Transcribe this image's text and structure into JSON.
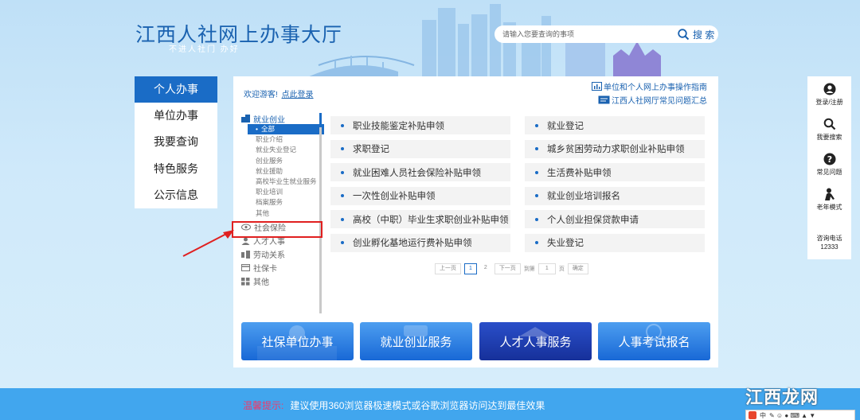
{
  "header": {
    "title": "江西人社网上办事大厅",
    "slogan": "不进人社门 办好",
    "search_placeholder": "请输入您要查询的事项",
    "search_label": "搜 索"
  },
  "left_menu": [
    {
      "label": "个人办事",
      "active": true
    },
    {
      "label": "单位办事",
      "active": false
    },
    {
      "label": "我要查询",
      "active": false
    },
    {
      "label": "特色服务",
      "active": false
    },
    {
      "label": "公示信息",
      "active": false
    }
  ],
  "panel": {
    "welcome_text": "欢迎游客!",
    "login_link": "点此登录",
    "guide_link": "单位和个人网上办事操作指南",
    "faq_link": "江西人社网厅常见问题汇总"
  },
  "categories": {
    "employment": {
      "label": "就业创业",
      "subs": [
        "全部",
        "职业介绍",
        "就业失业登记",
        "创业服务",
        "就业援助",
        "高校毕业生就业服务",
        "职业培训",
        "档案服务",
        "其他"
      ]
    },
    "others": [
      {
        "label": "社会保险",
        "icon": "eye-icon"
      },
      {
        "label": "人才人事",
        "icon": "person-icon"
      },
      {
        "label": "劳动关系",
        "icon": "handshake-icon"
      },
      {
        "label": "社保卡",
        "icon": "card-icon"
      },
      {
        "label": "其他",
        "icon": "grid-icon"
      }
    ]
  },
  "services": [
    "职业技能鉴定补贴申领",
    "就业登记",
    "求职登记",
    "城乡贫困劳动力求职创业补贴申领",
    "就业困难人员社会保险补贴申领",
    "生活费补贴申领",
    "一次性创业补贴申领",
    "就业创业培训报名",
    "高校（中职）毕业生求职创业补贴申领",
    "个人创业担保贷款申请",
    "创业孵化基地运行费补贴申领",
    "失业登记"
  ],
  "pager": {
    "prev": "上一页",
    "pages": [
      "1",
      "2"
    ],
    "next": "下一页",
    "goto_label": "到第",
    "goto_value": "1",
    "page_unit": "页",
    "confirm": "确定"
  },
  "banners": [
    "社保单位办事",
    "就业创业服务",
    "人才人事服务",
    "人事考试报名"
  ],
  "float_bar": {
    "login": "登录/注册",
    "search": "我要搜索",
    "faq": "常见问题",
    "elder": "老年模式",
    "hotline_label": "咨询电话",
    "hotline_number": "12333"
  },
  "footer": {
    "tip_label": "温馨提示:",
    "tip_text": "建议使用360浏览器极速模式或谷歌浏览器访问达到最佳效果"
  },
  "watermark": {
    "text": "江西龙网",
    "ime_indicator": "中"
  },
  "colors": {
    "primary": "#1a6cc6",
    "link": "#1a62b0",
    "highlight": "#e02020",
    "footer": "#41a6ee"
  }
}
